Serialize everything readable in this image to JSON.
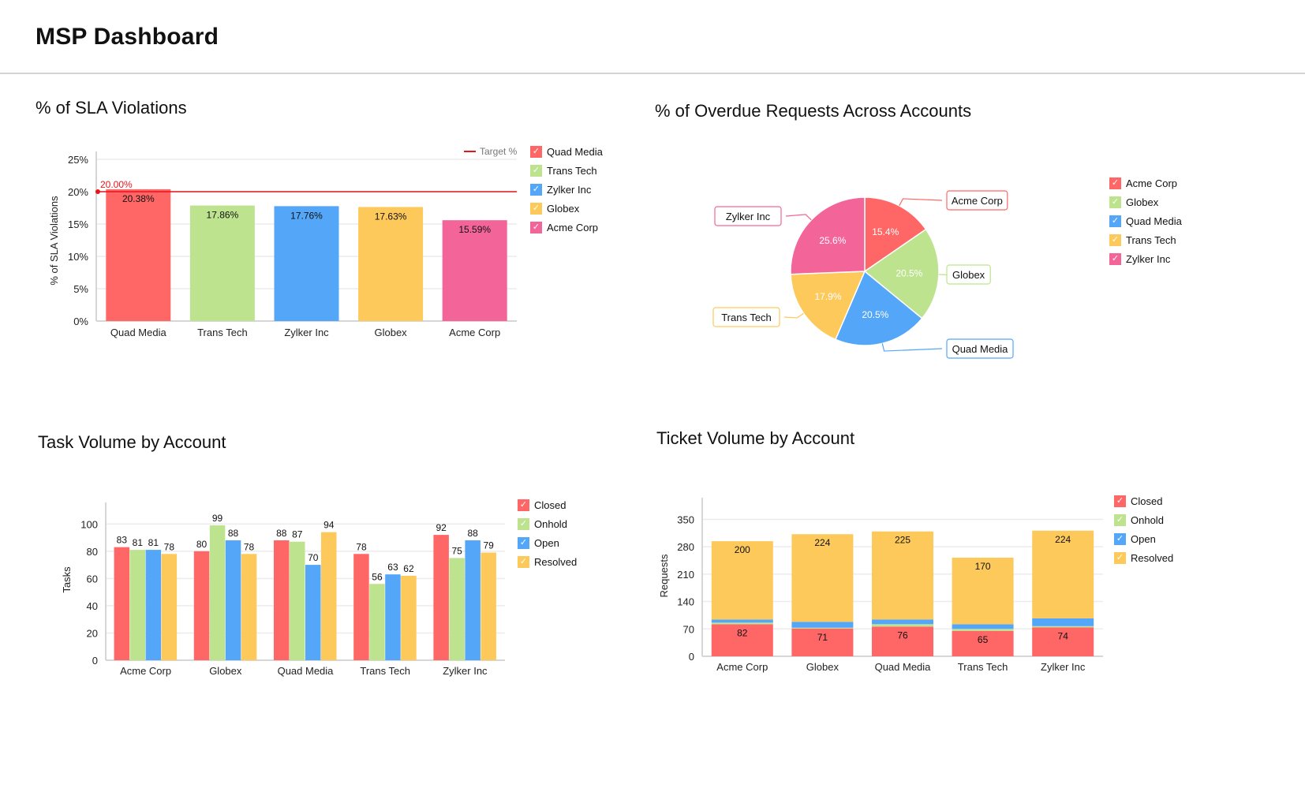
{
  "header": {
    "title": "MSP Dashboard"
  },
  "colors": {
    "red": "#FF6666",
    "green": "#BDE38E",
    "blue": "#54A6F8",
    "yellow": "#FDC95A",
    "pink": "#F36598",
    "target": "#E8141B"
  },
  "chart_data": [
    {
      "id": "sla",
      "type": "bar",
      "title": "% of SLA Violations",
      "xlabel": "",
      "ylabel": "% of SLA Violations",
      "categories": [
        "Quad Media",
        "Trans Tech",
        "Zylker Inc",
        "Globex",
        "Acme Corp"
      ],
      "values": [
        20.38,
        17.86,
        17.76,
        17.63,
        15.59
      ],
      "value_labels": [
        "20.38%",
        "17.86%",
        "17.76%",
        "17.63%",
        "15.59%"
      ],
      "bar_colors": [
        "#FF6666",
        "#BDE38E",
        "#54A6F8",
        "#FDC95A",
        "#F36598"
      ],
      "ylim": [
        0,
        25
      ],
      "yticks": [
        0,
        5,
        10,
        15,
        20,
        25
      ],
      "ytick_labels": [
        "0%",
        "5%",
        "10%",
        "15%",
        "20%",
        "25%"
      ],
      "target_line": {
        "name": "Target %",
        "value": 20,
        "label": "20.00%"
      },
      "legend": [
        "Quad Media",
        "Trans Tech",
        "Zylker Inc",
        "Globex",
        "Acme Corp"
      ],
      "legend_position": "right",
      "grid": true
    },
    {
      "id": "overdue",
      "type": "pie",
      "title": "% of Overdue Requests Across Accounts",
      "categories": [
        "Acme Corp",
        "Globex",
        "Quad Media",
        "Trans Tech",
        "Zylker Inc"
      ],
      "values": [
        15.4,
        20.5,
        20.5,
        17.9,
        25.6
      ],
      "value_labels": [
        "15.4%",
        "20.5%",
        "20.5%",
        "17.9%",
        "25.6%"
      ],
      "colors": [
        "#FF6666",
        "#BDE38E",
        "#54A6F8",
        "#FDC95A",
        "#F36598"
      ],
      "legend": [
        "Acme Corp",
        "Globex",
        "Quad Media",
        "Trans Tech",
        "Zylker Inc"
      ],
      "legend_position": "right"
    },
    {
      "id": "tasks",
      "type": "bar",
      "title": "Task Volume by Account",
      "xlabel": "",
      "ylabel": "Tasks",
      "categories": [
        "Acme Corp",
        "Globex",
        "Quad Media",
        "Trans Tech",
        "Zylker Inc"
      ],
      "series": [
        {
          "name": "Closed",
          "color": "#FF6666",
          "values": [
            83,
            80,
            88,
            78,
            92
          ]
        },
        {
          "name": "Onhold",
          "color": "#BDE38E",
          "values": [
            81,
            99,
            87,
            56,
            75
          ]
        },
        {
          "name": "Open",
          "color": "#54A6F8",
          "values": [
            81,
            88,
            70,
            63,
            88
          ]
        },
        {
          "name": "Resolved",
          "color": "#FDC95A",
          "values": [
            78,
            78,
            94,
            62,
            79
          ]
        }
      ],
      "ylim": [
        0,
        110
      ],
      "yticks": [
        0,
        20,
        40,
        60,
        80,
        100
      ],
      "legend_position": "right",
      "grid": true
    },
    {
      "id": "tickets",
      "type": "bar",
      "stacked": true,
      "title": "Ticket Volume by Account",
      "xlabel": "",
      "ylabel": "Requests",
      "categories": [
        "Acme Corp",
        "Globex",
        "Quad Media",
        "Trans Tech",
        "Zylker Inc"
      ],
      "series": [
        {
          "name": "Closed",
          "color": "#FF6666",
          "values": [
            82,
            71,
            76,
            65,
            74
          ],
          "labeled": true
        },
        {
          "name": "Onhold",
          "color": "#BDE38E",
          "values": [
            4,
            2,
            6,
            5,
            3
          ],
          "labeled": false
        },
        {
          "name": "Open",
          "color": "#54A6F8",
          "values": [
            8,
            15,
            12,
            12,
            20
          ],
          "labeled": false
        },
        {
          "name": "Resolved",
          "color": "#FDC95A",
          "values": [
            200,
            224,
            225,
            170,
            224
          ],
          "labeled": true
        }
      ],
      "ylim": [
        0,
        385
      ],
      "yticks": [
        0,
        70,
        140,
        210,
        280,
        350
      ],
      "legend_position": "right",
      "grid": true
    }
  ]
}
